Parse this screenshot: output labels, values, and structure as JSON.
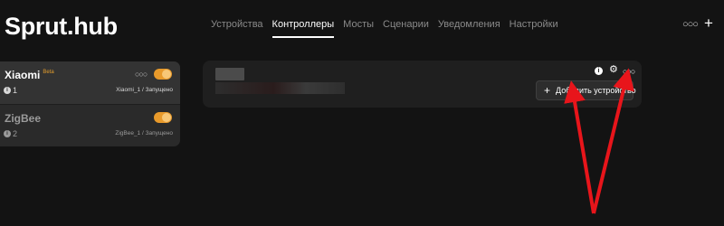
{
  "app": {
    "title": "Sprut.hub"
  },
  "nav": {
    "tabs": [
      {
        "label": "Устройства",
        "active": false
      },
      {
        "label": "Контроллеры",
        "active": true
      },
      {
        "label": "Мосты",
        "active": false
      },
      {
        "label": "Сценарии",
        "active": false
      },
      {
        "label": "Уведомления",
        "active": false
      },
      {
        "label": "Настройки",
        "active": false
      }
    ],
    "more_icon": "more-dots-icon",
    "add_icon": "plus-icon"
  },
  "controllers": [
    {
      "name": "Xiaomi",
      "badge": "Beta",
      "count": "1",
      "status": "Xiaomi_1 / Запущено",
      "enabled": true
    },
    {
      "name": "ZigBee",
      "badge": "",
      "count": "2",
      "status": "ZigBee_1 / Запущено",
      "enabled": true
    }
  ],
  "panel": {
    "add_device_label": "Добавить устройство",
    "info_icon": "info-icon",
    "settings_icon": "gear-icon",
    "more_icon": "more-dots-icon"
  },
  "colors": {
    "background": "#131313",
    "accent": "#e89a2b",
    "annotation_arrow": "#e8151b"
  }
}
